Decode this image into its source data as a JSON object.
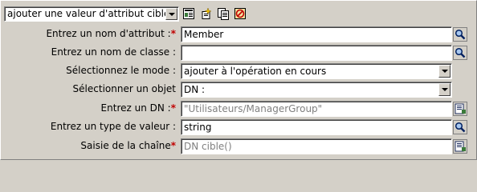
{
  "toolbar": {
    "action_value": "ajouter une valeur d'attribut cible",
    "icons": [
      "action-editor-icon",
      "add-action-icon",
      "copy-action-icon",
      "delete-action-icon"
    ]
  },
  "form": {
    "rows": [
      {
        "label": "Entrez un nom d'attribut :",
        "required": "*",
        "value": "Member",
        "placeholder": "",
        "kind": "text",
        "button": "browse-icon"
      },
      {
        "label": "Entrez un nom de classe :",
        "required": "",
        "value": "",
        "placeholder": "",
        "kind": "text",
        "button": "browse-icon"
      },
      {
        "label": "Sélectionnez le mode :",
        "required": "",
        "value": "ajouter à l'opération en cours",
        "placeholder": "",
        "kind": "select",
        "button": ""
      },
      {
        "label": "Sélectionner un objet",
        "required": "",
        "value": "DN :",
        "placeholder": "",
        "kind": "select",
        "button": ""
      },
      {
        "label": "Entrez un DN :",
        "required": "*",
        "value": "",
        "placeholder": "\"Utilisateurs/ManagerGroup\"",
        "kind": "text",
        "button": "argument-builder-icon"
      },
      {
        "label": "Entrez un type de valeur :",
        "required": "",
        "value": "string",
        "placeholder": "",
        "kind": "text",
        "button": "browse-icon"
      },
      {
        "label": "Saisie de la chaîne",
        "required": "*",
        "value": "",
        "placeholder": "DN cible()",
        "kind": "text",
        "button": "argument-builder-icon"
      }
    ]
  },
  "colors": {
    "background": "#d4d0c8",
    "required": "#c00000",
    "placeholder": "#808080"
  }
}
